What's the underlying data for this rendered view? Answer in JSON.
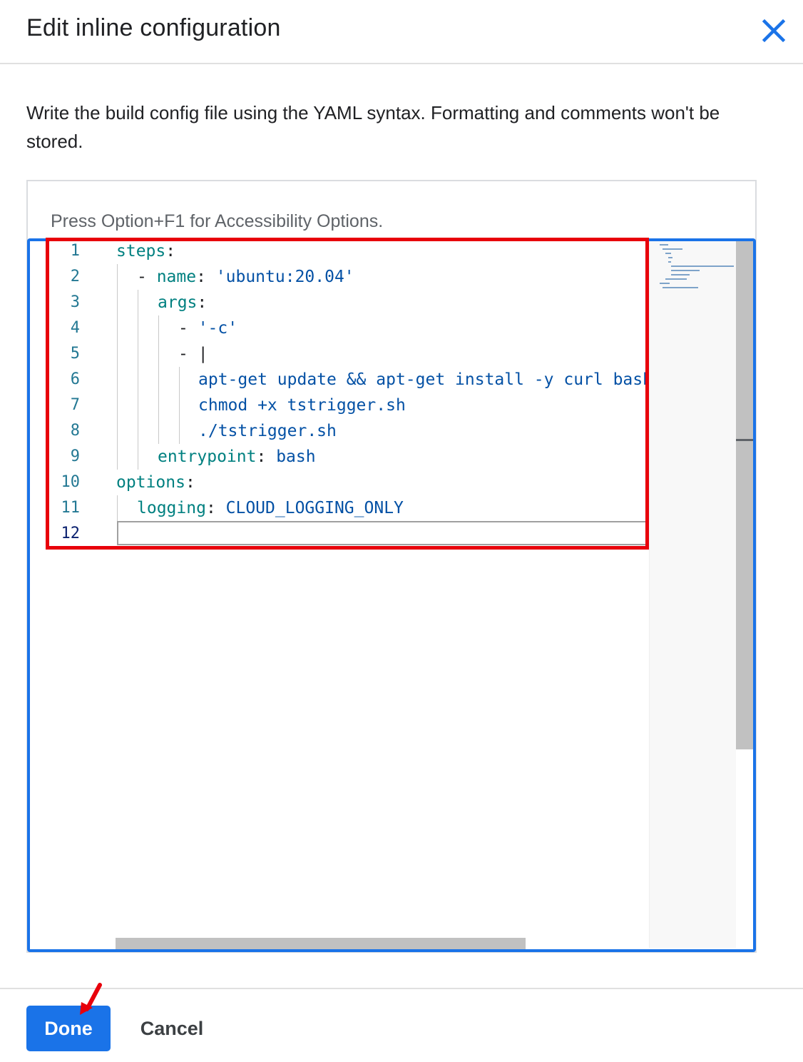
{
  "dialog": {
    "title": "Edit inline configuration",
    "close_icon": "close-icon"
  },
  "description": "Write the build config file using the YAML syntax. Formatting and comments won't be stored.",
  "editor": {
    "accessibility_hint": "Press Option+F1 for Accessibility Options.",
    "line_numbers": [
      "1",
      "2",
      "3",
      "4",
      "5",
      "6",
      "7",
      "8",
      "9",
      "10",
      "11",
      "12"
    ],
    "lines": [
      {
        "key": "steps",
        "punct": ":",
        "value": ""
      },
      {
        "prefix": "- ",
        "key": "name",
        "punct": ": ",
        "value": "'ubuntu:20.04'"
      },
      {
        "key": "args",
        "punct": ":",
        "value": ""
      },
      {
        "prefix": "- ",
        "value": "'-c'"
      },
      {
        "prefix": "- ",
        "punct": "|"
      },
      {
        "value": "apt-get update && apt-get install -y curl bash"
      },
      {
        "value": "chmod +x tstrigger.sh"
      },
      {
        "value": "./tstrigger.sh"
      },
      {
        "key": "entrypoint",
        "punct": ": ",
        "value": "bash"
      },
      {
        "key": "options",
        "punct": ":",
        "value": ""
      },
      {
        "key": "logging",
        "punct": ": ",
        "value": "CLOUD_LOGGING_ONLY"
      },
      {
        "value": ""
      }
    ]
  },
  "footer": {
    "done_label": "Done",
    "cancel_label": "Cancel"
  },
  "colors": {
    "accent": "#1a73e8",
    "annotation": "#e8000b",
    "yaml_key": "#008080",
    "yaml_value": "#0451a5"
  }
}
